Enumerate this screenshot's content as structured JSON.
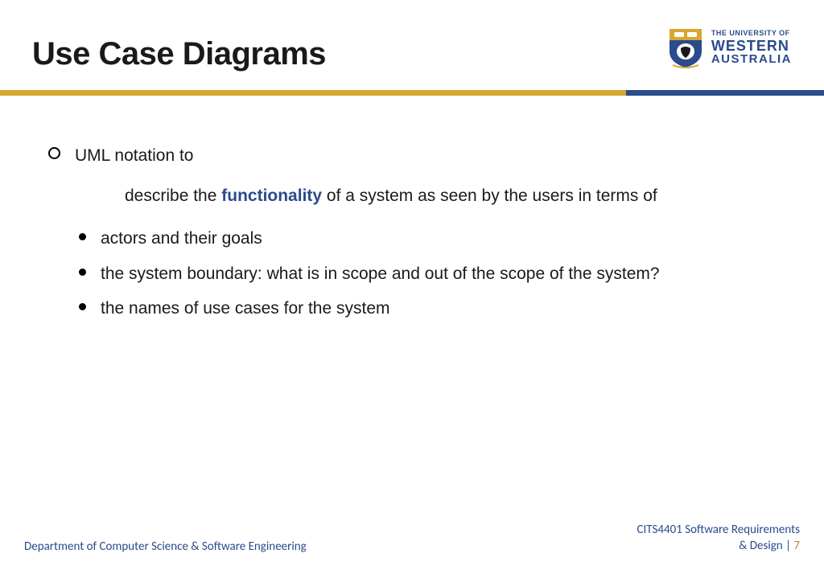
{
  "title": "Use Case Diagrams",
  "logo": {
    "line1": "THE UNIVERSITY OF",
    "line2": "WESTERN",
    "line3": "AUSTRALIA"
  },
  "content": {
    "main_bullet": "UML notation to",
    "description_pre": "describe the ",
    "description_highlight": "functionality",
    "description_post": " of a system as seen by the users in terms of",
    "sub_bullets": [
      "actors and their goals",
      "the system boundary: what is in scope and out of the scope of the system?",
      "the names of use cases for the system"
    ]
  },
  "footer": {
    "left": "Department of Computer Science & Software Engineering",
    "right_line1": "CITS4401 Software Requirements",
    "right_line2_pre": "& Design | ",
    "page_number": "7"
  }
}
